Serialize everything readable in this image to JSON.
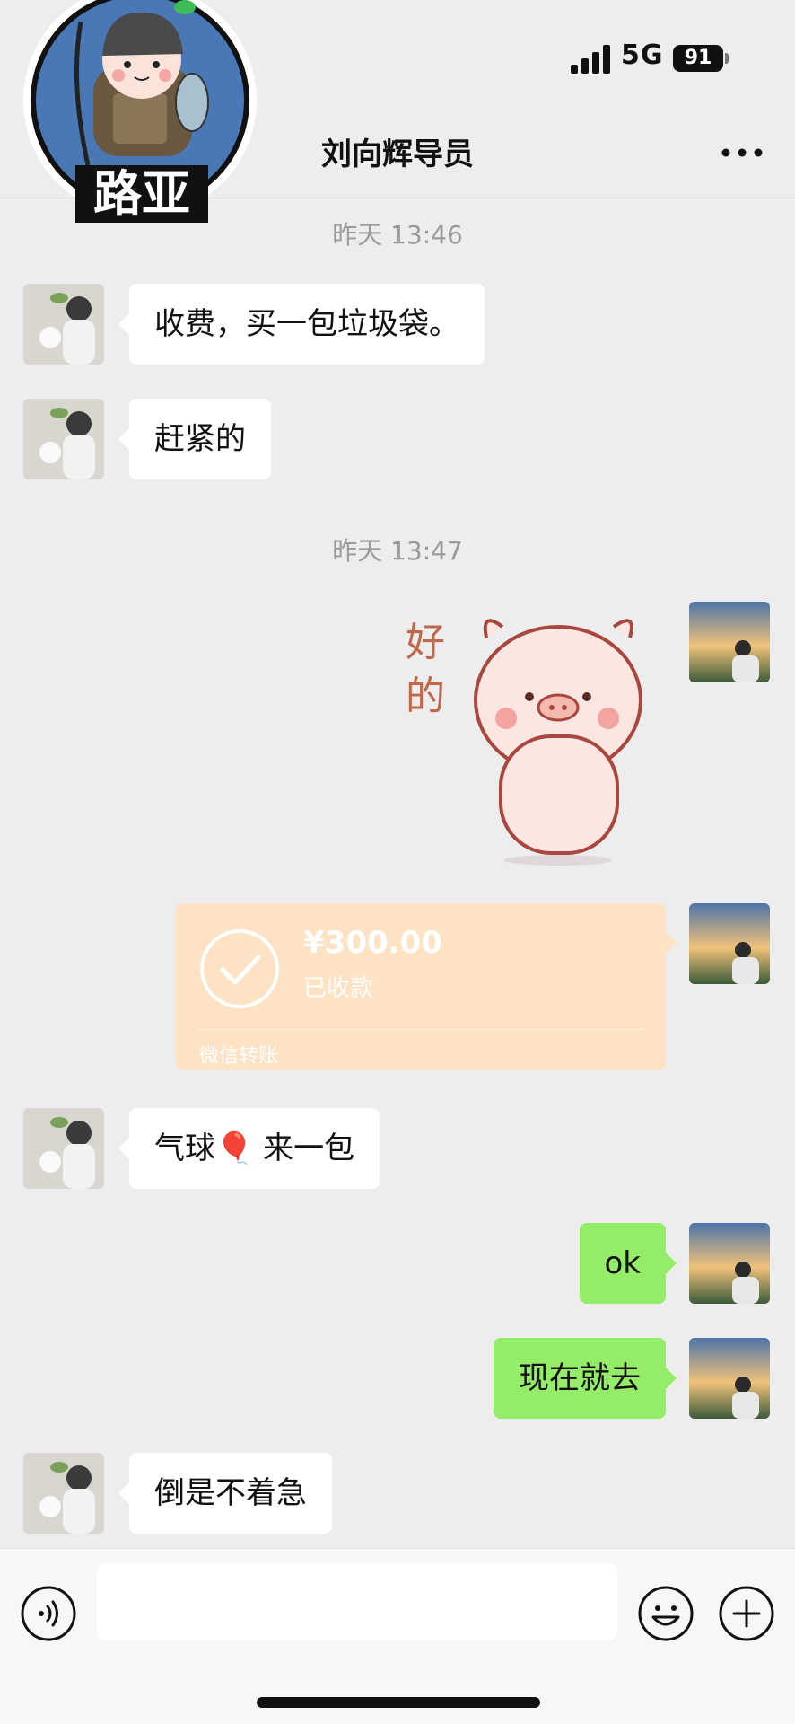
{
  "status_bar": {
    "network": "5G",
    "battery": "91",
    "signal_icon": "signal-bars-icon"
  },
  "sticker": {
    "text": "路亚"
  },
  "header": {
    "title": "刘向辉导员",
    "more_icon": "more-dots-icon"
  },
  "chat": {
    "timestamps": [
      "昨天 13:46",
      "昨天 13:47"
    ],
    "messages": [
      {
        "side": "left",
        "text": "收费，买一包垃圾袋。"
      },
      {
        "side": "left",
        "text": "赶紧的"
      },
      {
        "side": "right",
        "type": "sticker",
        "sticker_text": "好的"
      },
      {
        "side": "right",
        "type": "transfer",
        "amount": "¥300.00",
        "status": "已收款",
        "footer": "微信转账"
      },
      {
        "side": "left",
        "text": "气球🎈 来一包"
      },
      {
        "side": "right",
        "text": "ok"
      },
      {
        "side": "right",
        "text": "现在就去"
      },
      {
        "side": "left",
        "text": "倒是不着急"
      }
    ]
  },
  "input_bar": {
    "voice_icon": "voice-icon",
    "input_value": "",
    "emoji_icon": "emoji-icon",
    "plus_icon": "plus-icon"
  },
  "colors": {
    "bubble_right": "#95ec69",
    "bubble_left": "#ffffff",
    "background": "#ededed",
    "transfer": "#fde2c3"
  }
}
